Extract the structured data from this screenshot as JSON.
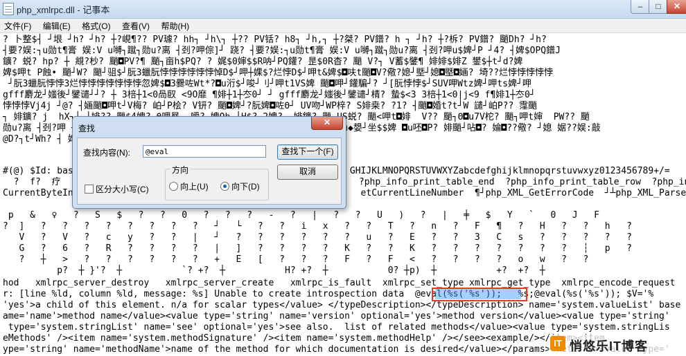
{
  "window": {
    "title": "php_xmlrpc.dll - 记事本"
  },
  "menu": [
    "文件(F)",
    "编辑(E)",
    "格式(O)",
    "查看(V)",
    "帮助(H)"
  ],
  "editor_lines": [
    "? 卜整$┤ ┘垠 ┘h? ┘h? ┼?峴¶?? PV璩? hh┐ ┘h\\┐ ┼?? PV铦? h8┐ ┘h,┐ ┼?桀? PV鐠? h ┐ ┘h? ┼?柝? PV鐠? 颵Dh? ┘h?",
    "┤要?娱:┐u勋t¶膏 娱:V u嚩┐蹴┐勋u?离 ┤刭?呷倧]┘ 跷? ┤要?娱:┐u勋t¶膏 娱:V u嚩┐蹴┐勋u?离 ┤刭?呷u$婢┘P ┘4? ┤婢$OPQ鐠J",
    "鑛? 蜕? hp? ┼ 覜?杪? 颵◘PV?¶ 颵┐亩h$PQ? ? 娓$0婶$$R呐┘PQ鑵? 昰$0R杳? 颵 V?┐ V蓄$鐾¶ 婔婔$婔Z 鐢$┼t┘d?婢",
    "婢$呷t P蝕• 颵┘W? 颵┘驵$┘朊3蠟朊悖悖悖悖悖悖悼D$┘呷┼婐$?烂悖D$┘呷t&婢$◘呋t颵◘V?儆?媳┘塈┘媳◘塈◘婳? 埼??烂悖悖悖悖悖",
    " ┘朊3蠟朊悖悖3烂悖悖悖悖悖悖悖忽婢$◘3爨咗Wt*?◘u洐$┘唆┘刂┘呷t1VS婢 颵◘呷┘鑵騙┘? ┘[朊悖悖$┘SUV呷Wtz婢┘呷ts婢┘呷",
    "gfff麝龙┘媸後┘鐾谴┘┘? ┼ 3棓┼1<0咼臤 <9O靡 ¶婔┼1┼冭0┘ ┘ gfff麝龙┘媸後┘鐾谴┘棈? 蟄$<3 3棓┼1<0|j<9 f¶婔1┼冭0┘",
    "悖悖悖Vj4j ┘@? ┤婳颵◘呷t┘V梅? 岶┘P桧? V钘? 颵◘婢┘?朊婢◘咗Θ┘ UV吻┘WP梓? S婔桒? ?1? ┤颵◘婚t?t┘W 譴┘岶P?? 霪颵",
    "┐ 婔鑛? j  hX┐┘ ┼婔?? 颵$4婢? Θ哩晷 ┐嗳? 婢Oh ┘H$? 2婢?  婔鑛? 颵 US蜕? 颵<呷t◘婔  V?? 颵┐Θ◘u7V柁? 颵┐呷t婶  PW?? 颵",
    "勋u?离 ┤刭?呷 ┘ ┘  ┘  ┘  ┘  ┘  ┘  ┘  ┘  ┘  ┘  ┘  ┘  ┘ 婢┘ ┘┤蘇?呋u◆嫢┘坐$$婢 ◘u呸◘P? 婔颵┘呫◘? 婨◘??儆? ┘媳 婮??娱:敲",
    "@D?┐t┘Wh? ┤ 婢$QV婢? 颵◘婢_[朊悖SVW婢$]3菎 ┼峭┘?3嘫婢?¶j j P铦? 婻颵",
    "",
    "#(@) $Id: bas                                                   GHIJKLMNOPQRSTUVWXYZabcdefghijklmnopqrstuvwxyz0123456789+/=",
    "  ?  f?  疗                                                       ?php_info_print_table_end  ?php_info_print_table_row  ?php_in",
    "CurrentByteIn                                                     etCurrentLineNumber  ¶┘php_XML_GetErrorCode  ┘┴php_XML_Parse",
    "",
    " p   &   ♀   ?   S   $   ?   ?   0   ?   ?   ?   -   ?   |   ?   ?   U   )   ?   |   ╪   $   Y   `   0   J   F",
    "?  ]   ?   ?   ?   ?   ?   ?   ?   ?   ┘   └   ?   ?   i   x   ?   ?   T   ?   n   ?   F   ¶   ?   H   ?   ?   h   ?",
    "   V   ?   V   ?   c   y   ?   ?   |   ┘   ?   ?   ?   ?   ?   ?   u   ?   E   ?   ?   3   C   s   ?   ?   ?   ?   ?",
    "   G   ?   6   ?   R   ?   ?   ?   ?   |   ]   ?   ?   ?   ?   K   ?   ?   K   ?   ?   ?   ?   ?   ?   ?   ┆   p   ?",
    "   ?   ┼   >   ?   ?   ?   ?   ?   ?   +   E   [   ?   ?   ?   F   ?   F   <   ?   ?   ?   ?   o   w   ?   ?",
    "          p?  ┼ }'?  ┼           `? +?  ┼           H? +?  ┼           0? ┼p)  ┼           +?  +?  ┼",
    "hod   xmlrpc_server_destroy   xmlrpc_server_create   xmlrpc_is_fault  xmlrpc_set_type xmlrpc_get_type  xmlrpc_encode_request",
    "r: [line %ld, column %ld, message: %s] Unable to create introspection data  @eval(%s('%s'));   %s;@eval(%s('%s')); $V='%",
    "'yes'>a child of this element. n/a for scalar types</value> </typeDescription></typeDescription> name='system.valueList' base",
    "ame='name'>method name</value><value type='string' name='version' optional='yes'>method version</value><value type='string'",
    " type='system.stringList' name='see' optional='yes'>see also.  list of related methods</value><value type='system.stringLis",
    "eMethods' /><item name='system.methodSignature' /><item name='system.methodHelp' /></see><example/></item><item",
    "ype='string' name='methodName'>name of the method for which documentation is desired</value></params><returns><value type='"
  ],
  "find_dialog": {
    "title": "查找",
    "find_label": "查找内容(N):",
    "find_value": "@eval",
    "find_next_button": "查找下一个(F)",
    "cancel_button": "取消",
    "direction_label": "方向",
    "up_label": "向上(U)",
    "down_label": "向下(D)",
    "match_case_label": "区分大小写(C)",
    "direction_selected": "down",
    "match_case_checked": false
  },
  "watermark": {
    "text": "悄悠乐IT博客"
  }
}
